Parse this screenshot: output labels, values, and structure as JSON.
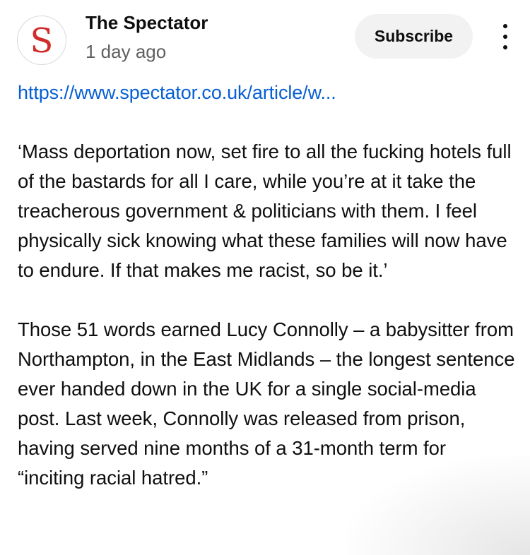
{
  "post": {
    "channel": {
      "avatar_letter": "S",
      "avatar_color": "#d22b2b",
      "name": "The Spectator"
    },
    "time_posted": "1 day ago",
    "subscribe_label": "Subscribe",
    "more_icon": "more-vert-icon",
    "link_text": "https://www.spectator.co.uk/article/w...",
    "link_color": "#065fd4",
    "paragraphs": [
      "‘Mass deportation now, set fire to all the fucking hotels full of the bastards for all I care, while you’re at it take the treacherous government & politicians with them. I feel physically sick knowing what these families will now have to endure. If that makes me racist, so be it.’",
      "Those 51 words earned Lucy Connolly – a babysitter from Northampton, in the East Midlands – the longest sentence ever handed down in the UK for a single social-media post. Last week, Connolly was released from prison, having served nine months of a 31-month term for “inciting racial hatred.”"
    ]
  }
}
